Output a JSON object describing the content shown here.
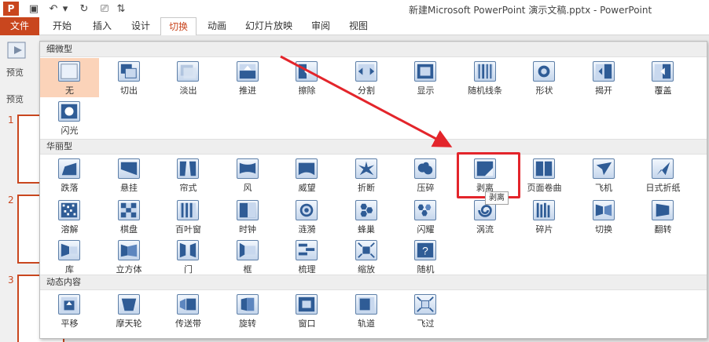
{
  "window": {
    "title": "新建Microsoft PowerPoint 演示文稿.pptx - PowerPoint",
    "quick_access": [
      {
        "icon": "powerpoint-logo-icon",
        "glyph": "P"
      },
      {
        "icon": "save-icon",
        "glyph": "▣"
      },
      {
        "icon": "undo-icon",
        "glyph": "↶"
      },
      {
        "icon": "undo-dropdown-icon",
        "glyph": "▾"
      },
      {
        "icon": "redo-icon",
        "glyph": "↻"
      },
      {
        "icon": "start-from-beginning-icon",
        "glyph": "⎚"
      },
      {
        "icon": "customize-qat-icon",
        "glyph": "⇅"
      }
    ]
  },
  "ribbon": {
    "tabs": [
      {
        "label": "文件",
        "kind": "file"
      },
      {
        "label": "开始"
      },
      {
        "label": "插入"
      },
      {
        "label": "设计"
      },
      {
        "label": "切换",
        "active": true
      },
      {
        "label": "动画"
      },
      {
        "label": "幻灯片放映"
      },
      {
        "label": "审阅"
      },
      {
        "label": "视图"
      }
    ],
    "preview": {
      "label": "预览",
      "group_label": "预览"
    }
  },
  "slides": {
    "numbers": [
      "1",
      "2",
      "3"
    ]
  },
  "gallery": {
    "sections": [
      {
        "title": "细微型",
        "items": [
          {
            "label": "无",
            "icon": "none",
            "selected": true
          },
          {
            "label": "切出",
            "icon": "cut"
          },
          {
            "label": "淡出",
            "icon": "fade"
          },
          {
            "label": "推进",
            "icon": "push"
          },
          {
            "label": "擦除",
            "icon": "wipe"
          },
          {
            "label": "分割",
            "icon": "split"
          },
          {
            "label": "显示",
            "icon": "reveal"
          },
          {
            "label": "随机线条",
            "icon": "random-bars"
          },
          {
            "label": "形状",
            "icon": "shape"
          },
          {
            "label": "揭开",
            "icon": "uncover"
          },
          {
            "label": "覆盖",
            "icon": "cover"
          },
          {
            "label": "闪光",
            "icon": "flash"
          }
        ]
      },
      {
        "title": "华丽型",
        "items": [
          {
            "label": "跌落",
            "icon": "fall-over"
          },
          {
            "label": "悬挂",
            "icon": "drape"
          },
          {
            "label": "帘式",
            "icon": "curtains"
          },
          {
            "label": "风",
            "icon": "wind"
          },
          {
            "label": "威望",
            "icon": "prestige"
          },
          {
            "label": "折断",
            "icon": "fracture"
          },
          {
            "label": "压碎",
            "icon": "crush"
          },
          {
            "label": "剥离",
            "icon": "peel-off"
          },
          {
            "label": "页面卷曲",
            "icon": "page-curl"
          },
          {
            "label": "飞机",
            "icon": "airplane"
          },
          {
            "label": "日式折纸",
            "icon": "origami"
          },
          {
            "label": "溶解",
            "icon": "dissolve"
          },
          {
            "label": "棋盘",
            "icon": "checkerboard"
          },
          {
            "label": "百叶窗",
            "icon": "blinds"
          },
          {
            "label": "时钟",
            "icon": "clock"
          },
          {
            "label": "涟漪",
            "icon": "ripple"
          },
          {
            "label": "蜂巢",
            "icon": "honeycomb"
          },
          {
            "label": "闪耀",
            "icon": "glitter"
          },
          {
            "label": "涡流",
            "icon": "vortex"
          },
          {
            "label": "碎片",
            "icon": "shred"
          },
          {
            "label": "切换",
            "icon": "switch"
          },
          {
            "label": "翻转",
            "icon": "flip"
          },
          {
            "label": "库",
            "icon": "gallery"
          },
          {
            "label": "立方体",
            "icon": "cube"
          },
          {
            "label": "门",
            "icon": "doors"
          },
          {
            "label": "框",
            "icon": "box"
          },
          {
            "label": "梳理",
            "icon": "comb"
          },
          {
            "label": "缩放",
            "icon": "zoom"
          },
          {
            "label": "随机",
            "icon": "random"
          }
        ]
      },
      {
        "title": "动态内容",
        "items": [
          {
            "label": "平移",
            "icon": "pan"
          },
          {
            "label": "摩天轮",
            "icon": "ferris-wheel"
          },
          {
            "label": "传送带",
            "icon": "conveyor"
          },
          {
            "label": "旋转",
            "icon": "rotate"
          },
          {
            "label": "窗口",
            "icon": "window"
          },
          {
            "label": "轨道",
            "icon": "orbit"
          },
          {
            "label": "飞过",
            "icon": "fly-through"
          }
        ]
      }
    ],
    "hover_tooltip": "剥离"
  },
  "colors": {
    "accent": "#c9461e",
    "selected_item": "#fbd3b9",
    "annotation_red": "#e3252b"
  }
}
